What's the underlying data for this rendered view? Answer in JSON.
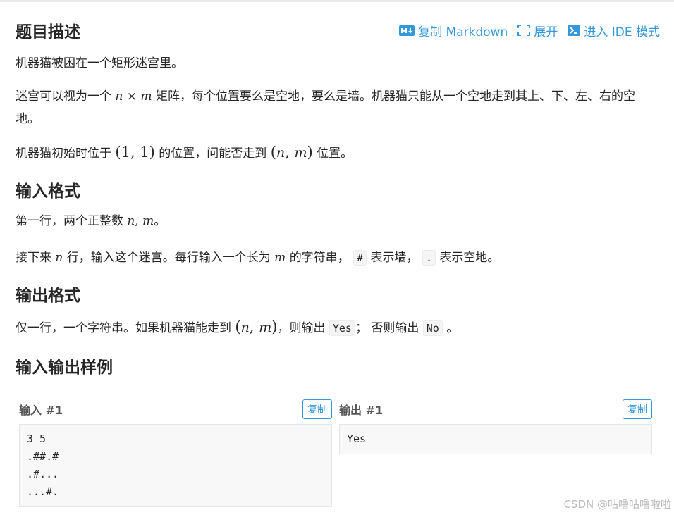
{
  "header": {
    "title": "题目描述",
    "actions": [
      {
        "icon": "markdown-icon",
        "label": "复制 Markdown"
      },
      {
        "icon": "expand-icon",
        "label": "展开"
      },
      {
        "icon": "terminal-icon",
        "label": "进入 IDE 模式"
      }
    ]
  },
  "description": {
    "p1": "机器猫被困在一个矩形迷宫里。",
    "p2_a": "迷宫可以视为一个",
    "p2_n": "n",
    "p2_times": "×",
    "p2_m": "m",
    "p2_b": "矩阵，每个位置要么是空地，要么是墙。机器猫只能从一个空地走到其上、下、左、右的空地。",
    "p3_a": "机器猫初始时位于",
    "p3_start": "(1, 1)",
    "p3_b": "的位置，问能否走到",
    "p3_target_n": "n",
    "p3_target_m": "m",
    "p3_c": "位置。"
  },
  "input_format": {
    "title": "输入格式",
    "line1_a": "第一行，两个正整数",
    "line1_n": "n",
    "line1_m": "m",
    "line1_b": "。",
    "line2_a": "接下来",
    "line2_n": "n",
    "line2_b": "行，输入这个迷宫。每行输入一个长为",
    "line2_m": "m",
    "line2_c": "的字符串，",
    "wall_code": "#",
    "line2_d": "表示墙，",
    "empty_code": ".",
    "line2_e": "表示空地。"
  },
  "output_format": {
    "title": "输出格式",
    "line_a": "仅一行，一个字符串。如果机器猫能走到",
    "line_n": "n",
    "line_m": "m",
    "line_b": "，则输出",
    "yes_code": "Yes",
    "line_c": "；  否则输出",
    "no_code": "No",
    "line_d": "。"
  },
  "samples": {
    "title": "输入输出样例",
    "input_title": "输入 #1",
    "output_title": "输出 #1",
    "copy_label": "复制",
    "input_text": "3 5\n.##.#\n.#...\n...#.",
    "output_text": "Yes"
  },
  "watermark": "CSDN @咕噜咕噜啦啦",
  "colors": {
    "accent": "#3498db",
    "text": "#262626",
    "code_bg": "#f8f8f8"
  }
}
